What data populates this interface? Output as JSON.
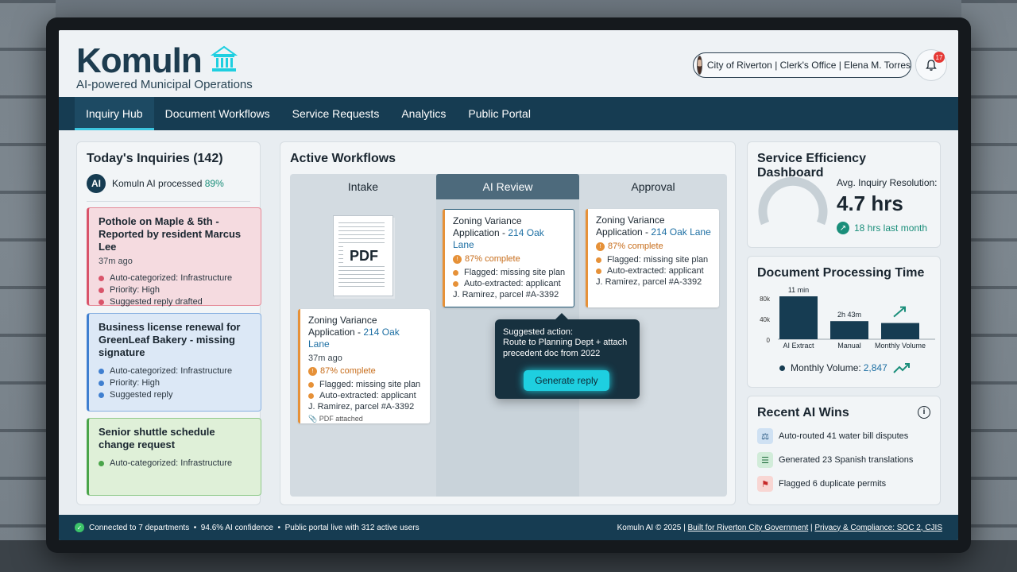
{
  "brand": {
    "name": "Komuln",
    "tagline": "AI-powered Municipal Operations"
  },
  "user": {
    "label": "City of Riverton | Clerk's Office | Elena M. Torres",
    "notifications": "17"
  },
  "nav": [
    "Inquiry Hub",
    "Document Workflows",
    "Service Requests",
    "Analytics",
    "Public Portal"
  ],
  "inquiries": {
    "title": "Today's Inquiries (142)",
    "ai_badge": "AI",
    "ai_text": "Komuln AI processed",
    "ai_pct": "89%",
    "cards": [
      {
        "title": "Pothole on Maple & 5th - Reported by resident Marcus Lee",
        "meta": "37m ago",
        "bullets": [
          "Auto-categorized: Infrastructure",
          "Priority: High",
          "Suggested reply drafted"
        ]
      },
      {
        "title": "Business license renewal for GreenLeaf Bakery - missing signature",
        "bullets": [
          "Auto-categorized: Infrastructure",
          "Priority: High",
          "Suggested reply"
        ]
      },
      {
        "title": "Senior shuttle schedule change request",
        "bullets": [
          "Auto-categorized: Infrastructure"
        ]
      }
    ]
  },
  "workflows": {
    "title": "Active Workflows",
    "columns": [
      "Intake",
      "AI Review",
      "Approval"
    ],
    "pdf_label": "PDF",
    "card": {
      "title": "Zoning Variance Application - ",
      "link": "214 Oak Lane",
      "meta": "37m ago",
      "pct": "87% complete",
      "b1": "Flagged: missing site plan",
      "b2": "Auto-extracted: applicant",
      "b3": "J. Ramirez, parcel #A-3392",
      "foot": "PDF attached"
    },
    "tooltip": {
      "title": "Suggested action:",
      "body": "Route to Planning Dept + attach precedent doc from 2022",
      "button": "Generate reply"
    }
  },
  "efficiency": {
    "title": "Service Efficiency Dashboard",
    "label": "Avg. Inquiry Resolution:",
    "value": "4.7 hrs",
    "delta": "18 hrs last month",
    "gauge_fraction": 0.26
  },
  "processing": {
    "title": "Document Processing Time",
    "volume_label": "Monthly Volume:",
    "volume_value": "2,847"
  },
  "chart_data": {
    "type": "bar",
    "categories": [
      "AI Extract",
      "Manual",
      "Monthly Volume"
    ],
    "value_labels": [
      "11 min",
      "2h 43m",
      ""
    ],
    "values": [
      90,
      38,
      34
    ],
    "ytick_labels": [
      "80k",
      "40k",
      "0"
    ],
    "ylim": [
      0,
      100
    ],
    "title": "Document Processing Time"
  },
  "wins": {
    "title": "Recent AI Wins",
    "items": [
      "Auto-routed 41 water bill disputes",
      "Generated 23 Spanish translations",
      "Flagged 6 duplicate permits"
    ]
  },
  "footer": {
    "left": "Connected to 7 departments  •  94.6% AI confidence  •  Public portal live with 312 active users",
    "copyright": "Komuln AI © 2025 | ",
    "link1": "Built for Riverton City Government",
    "sep": " | ",
    "link2": "Privacy & Compliance: SOC 2, CJIS"
  },
  "colors": {
    "navy": "#163c52",
    "accent": "#1ecfe0",
    "teal": "#1a8e7a"
  }
}
